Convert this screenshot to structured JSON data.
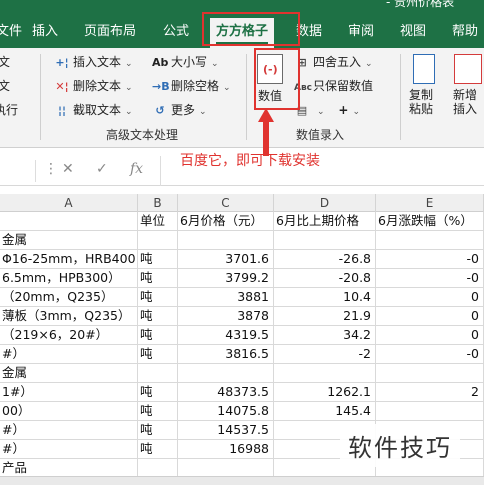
{
  "app": {
    "title": "- 贵州价格表",
    "tabs": [
      "文件",
      "插入",
      "页面布局",
      "公式",
      "方方格子",
      "数据",
      "审阅",
      "视图",
      "帮助"
    ],
    "active_tab": "方方格子"
  },
  "ribbon": {
    "left_partial": [
      "文",
      "文",
      "执行"
    ],
    "text_group": {
      "buttons": [
        "插入文本",
        "删除文本",
        "截取文本"
      ],
      "buttons2": [
        "大小写",
        "删除空格",
        "更多"
      ],
      "label": "高级文本处理"
    },
    "number_group": {
      "big_button": "数值",
      "buttons": [
        "四舍五入",
        "只保留数值"
      ],
      "label": "数值录入"
    },
    "other_buttons": [
      "复制粘贴",
      "新增插入"
    ]
  },
  "annotation": "百度它，即可下载安装",
  "formula_bar": {
    "fx_label": "fx"
  },
  "sheet": {
    "columns": [
      "A",
      "B",
      "C",
      "D",
      "E"
    ],
    "header_row": [
      "",
      "单位",
      "6月价格（元）",
      "6月比上期价格",
      "6月涨跌幅（%）"
    ],
    "rows": [
      [
        "金属",
        "",
        "",
        "",
        ""
      ],
      [
        "Φ16-25mm，HRB400",
        "吨",
        "3701.6",
        "-26.8",
        "-0"
      ],
      [
        "6.5mm，HPB300）",
        "吨",
        "3799.2",
        "-20.8",
        "-0"
      ],
      [
        "（20mm，Q235）",
        "吨",
        "3881",
        "10.4",
        "0"
      ],
      [
        "薄板（3mm，Q235）",
        "吨",
        "3878",
        "21.9",
        "0"
      ],
      [
        "（219×6，20#）",
        "吨",
        "4319.5",
        "34.2",
        "0"
      ],
      [
        "#）",
        "吨",
        "3816.5",
        "-2",
        "-0"
      ],
      [
        "金属",
        "",
        "",
        "",
        ""
      ],
      [
        "1#）",
        "吨",
        "48373.5",
        "1262.1",
        "2"
      ],
      [
        "00）",
        "吨",
        "14075.8",
        "145.4",
        ""
      ],
      [
        "#）",
        "吨",
        "14537.5",
        "",
        ""
      ],
      [
        "#）",
        "吨",
        "16988",
        "",
        ""
      ],
      [
        "产品",
        "",
        "",
        "",
        ""
      ]
    ]
  },
  "watermark": "软件技巧"
}
